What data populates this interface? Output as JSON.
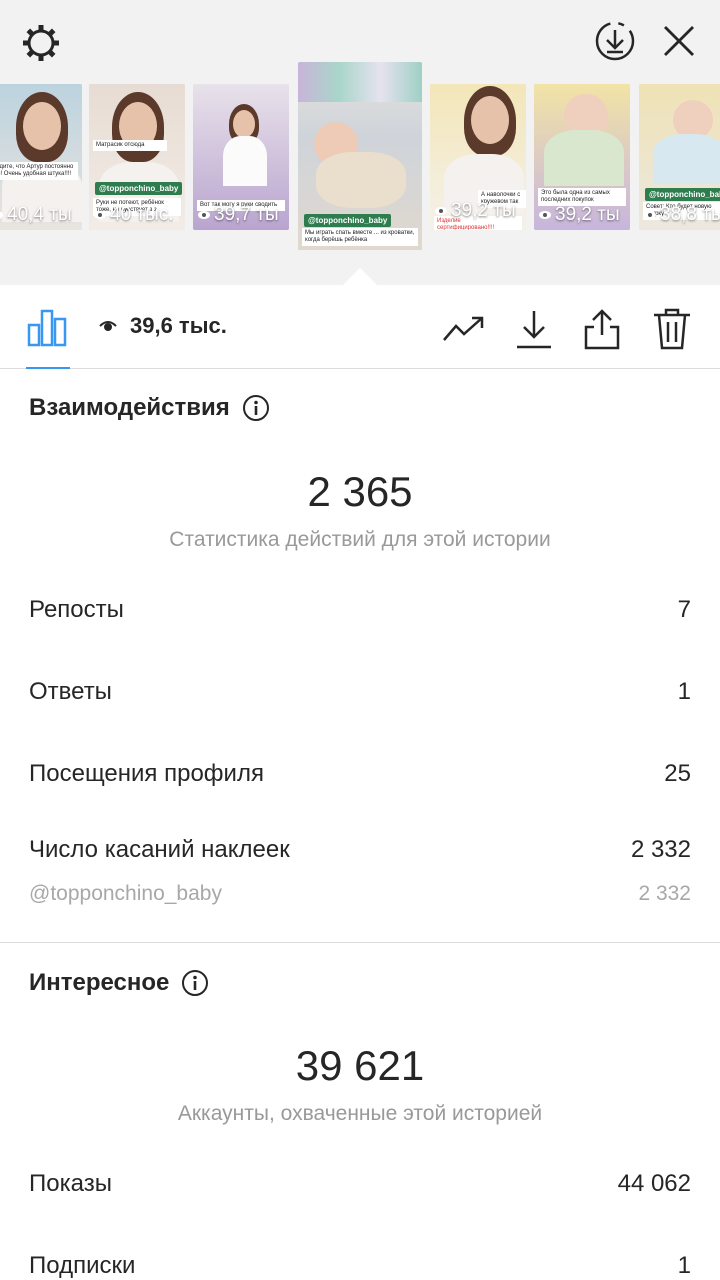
{
  "top_bar": {
    "settings_icon": "gear-icon",
    "download_icon": "download-circle-icon",
    "close_icon": "close-icon"
  },
  "thumbnails": [
    {
      "views": "40,4 ты",
      "caption": "видите, что Артур постоянно ем! Очень удобная штука!!!!",
      "tag": ""
    },
    {
      "views": "40 тыс.",
      "caption": "Руки не потеют, ребёнок тоже, не чувствует з з",
      "tag": "@topponchino_baby",
      "note": "Матрасик отсюда"
    },
    {
      "views": "39,7 ты",
      "caption": "Вот так могу я руки сводить",
      "tag": ""
    },
    {
      "views": "39,6 тыс.",
      "caption": "Мы играть спать вместе ... из кроватки, когда берёшь ребёнка",
      "tag": "@topponchino_baby",
      "active": true
    },
    {
      "views": "39,2 ты",
      "caption": "А наволочки с кружевом так",
      "tag": "",
      "note": "Изделие сертифицировано!!!!"
    },
    {
      "views": "39,2 ты",
      "caption": "Это была одна из самых последних покупок",
      "tag": ""
    },
    {
      "views": "38,8 ты",
      "caption": "Совет: Кто будет новую стирку",
      "tag": "@topponchino_baby"
    }
  ],
  "toolbar": {
    "views_label": "39,6 тыс.",
    "insights_icon": "bar-chart-icon",
    "promote_icon": "trending-up-icon",
    "download_icon": "download-icon",
    "share_icon": "share-icon",
    "delete_icon": "trash-icon"
  },
  "interactions": {
    "title": "Взаимодействия",
    "total": "2 365",
    "total_caption": "Статистика действий для этой истории",
    "rows": [
      {
        "label": "Репосты",
        "value": "7"
      },
      {
        "label": "Ответы",
        "value": "1"
      },
      {
        "label": "Посещения профиля",
        "value": "25"
      },
      {
        "label": "Число касаний наклеек",
        "value": "2 332"
      }
    ],
    "sticker_sub": {
      "label": "@topponchino_baby",
      "value": "2 332"
    }
  },
  "discovery": {
    "title": "Интересное",
    "total": "39 621",
    "total_caption": "Аккаунты, охваченные этой историей",
    "rows": [
      {
        "label": "Показы",
        "value": "44 062"
      },
      {
        "label": "Подписки",
        "value": "1"
      }
    ]
  },
  "colors": {
    "accent": "#3897f0",
    "text": "#262626",
    "secondary": "#999999",
    "top_bg": "#f2f2f2"
  }
}
